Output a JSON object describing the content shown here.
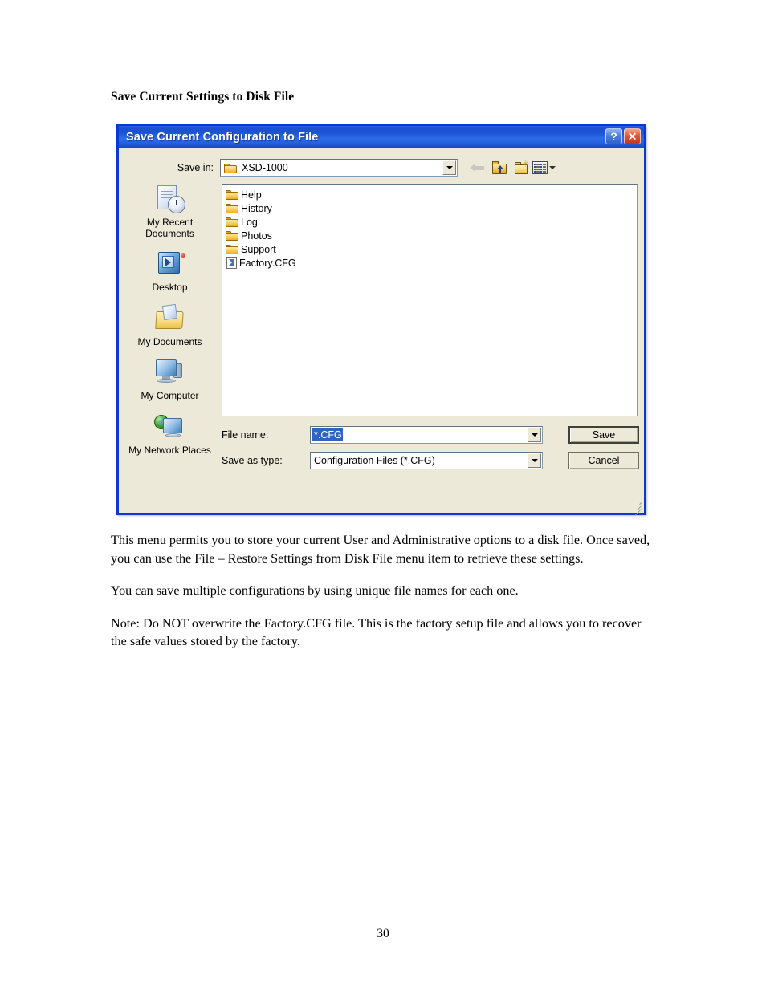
{
  "document": {
    "heading": "Save Current Settings to Disk File",
    "paragraphs": [
      "This menu permits you to store your current User and Administrative options to a disk file.  Once saved, you can use the File – Restore Settings from Disk File menu item to retrieve these settings.",
      "You can save multiple configurations by using unique file names for each one.",
      "Note: Do NOT overwrite the Factory.CFG file.  This is the factory setup file and allows you to recover the safe values stored by the factory."
    ],
    "page_number": "30"
  },
  "dialog": {
    "title": "Save Current Configuration to File",
    "titlebar_buttons": {
      "help": "?",
      "close": "✕"
    },
    "save_in": {
      "label": "Save in:",
      "value": "XSD-1000"
    },
    "toolbar": [
      {
        "name": "back-icon",
        "tooltip": "Back"
      },
      {
        "name": "up-one-level-icon",
        "tooltip": "Up One Level"
      },
      {
        "name": "new-folder-icon",
        "tooltip": "Create New Folder"
      },
      {
        "name": "views-icon",
        "tooltip": "Views"
      }
    ],
    "places": [
      {
        "label": "My Recent Documents",
        "icon": "recent-documents-icon"
      },
      {
        "label": "Desktop",
        "icon": "desktop-icon"
      },
      {
        "label": "My Documents",
        "icon": "my-documents-icon"
      },
      {
        "label": "My Computer",
        "icon": "my-computer-icon"
      },
      {
        "label": "My Network Places",
        "icon": "my-network-places-icon"
      }
    ],
    "files": [
      {
        "name": "Help",
        "type": "folder"
      },
      {
        "name": "History",
        "type": "folder"
      },
      {
        "name": "Log",
        "type": "folder"
      },
      {
        "name": "Photos",
        "type": "folder"
      },
      {
        "name": "Support",
        "type": "folder"
      },
      {
        "name": "Factory.CFG",
        "type": "file"
      }
    ],
    "file_name": {
      "label": "File name:",
      "value": "*.CFG"
    },
    "save_as_type": {
      "label": "Save as type:",
      "value": "Configuration Files (*.CFG)"
    },
    "buttons": {
      "save": "Save",
      "cancel": "Cancel"
    }
  },
  "colors": {
    "titlebar_blue": "#1b53d8",
    "dialog_face": "#ece9d8",
    "selection_blue": "#2f63c4",
    "close_red": "#c0341c"
  }
}
